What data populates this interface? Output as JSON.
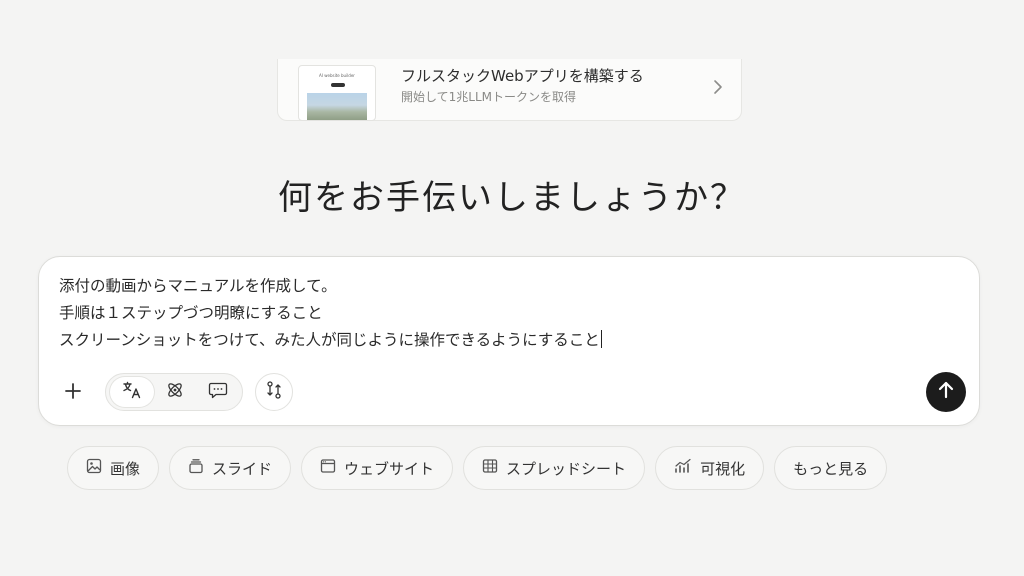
{
  "promo": {
    "thumbnail_title": "AI website builder",
    "title": "フルスタックWebアプリを構築する",
    "subtitle": "開始して1兆LLMトークンを取得",
    "chevron_icon": "chevron-right-icon"
  },
  "headline": "何をお手伝いしましょうか？",
  "composer": {
    "lines": [
      "添付の動画からマニュアルを作成して。",
      "手順は１ステップづつ明瞭にすること",
      "スクリーンショットをつけて、みた人が同じように操作できるようにすること"
    ],
    "tools": {
      "add_icon": "plus-icon",
      "translate_icon": "translate-icon",
      "agent_icon": "atom-icon",
      "chat_icon": "chat-bubble-icon",
      "connector_icon": "connector-icon",
      "send_icon": "arrow-up-icon"
    }
  },
  "chips": [
    {
      "label": "画像",
      "icon": "image-icon"
    },
    {
      "label": "スライド",
      "icon": "slides-icon"
    },
    {
      "label": "ウェブサイト",
      "icon": "browser-icon"
    },
    {
      "label": "スプレッドシート",
      "icon": "table-icon"
    },
    {
      "label": "可視化",
      "icon": "chart-icon"
    },
    {
      "label": "もっと見る",
      "icon": ""
    }
  ],
  "colors": {
    "background": "#f4f4f3",
    "send_button": "#1c1c1c"
  }
}
